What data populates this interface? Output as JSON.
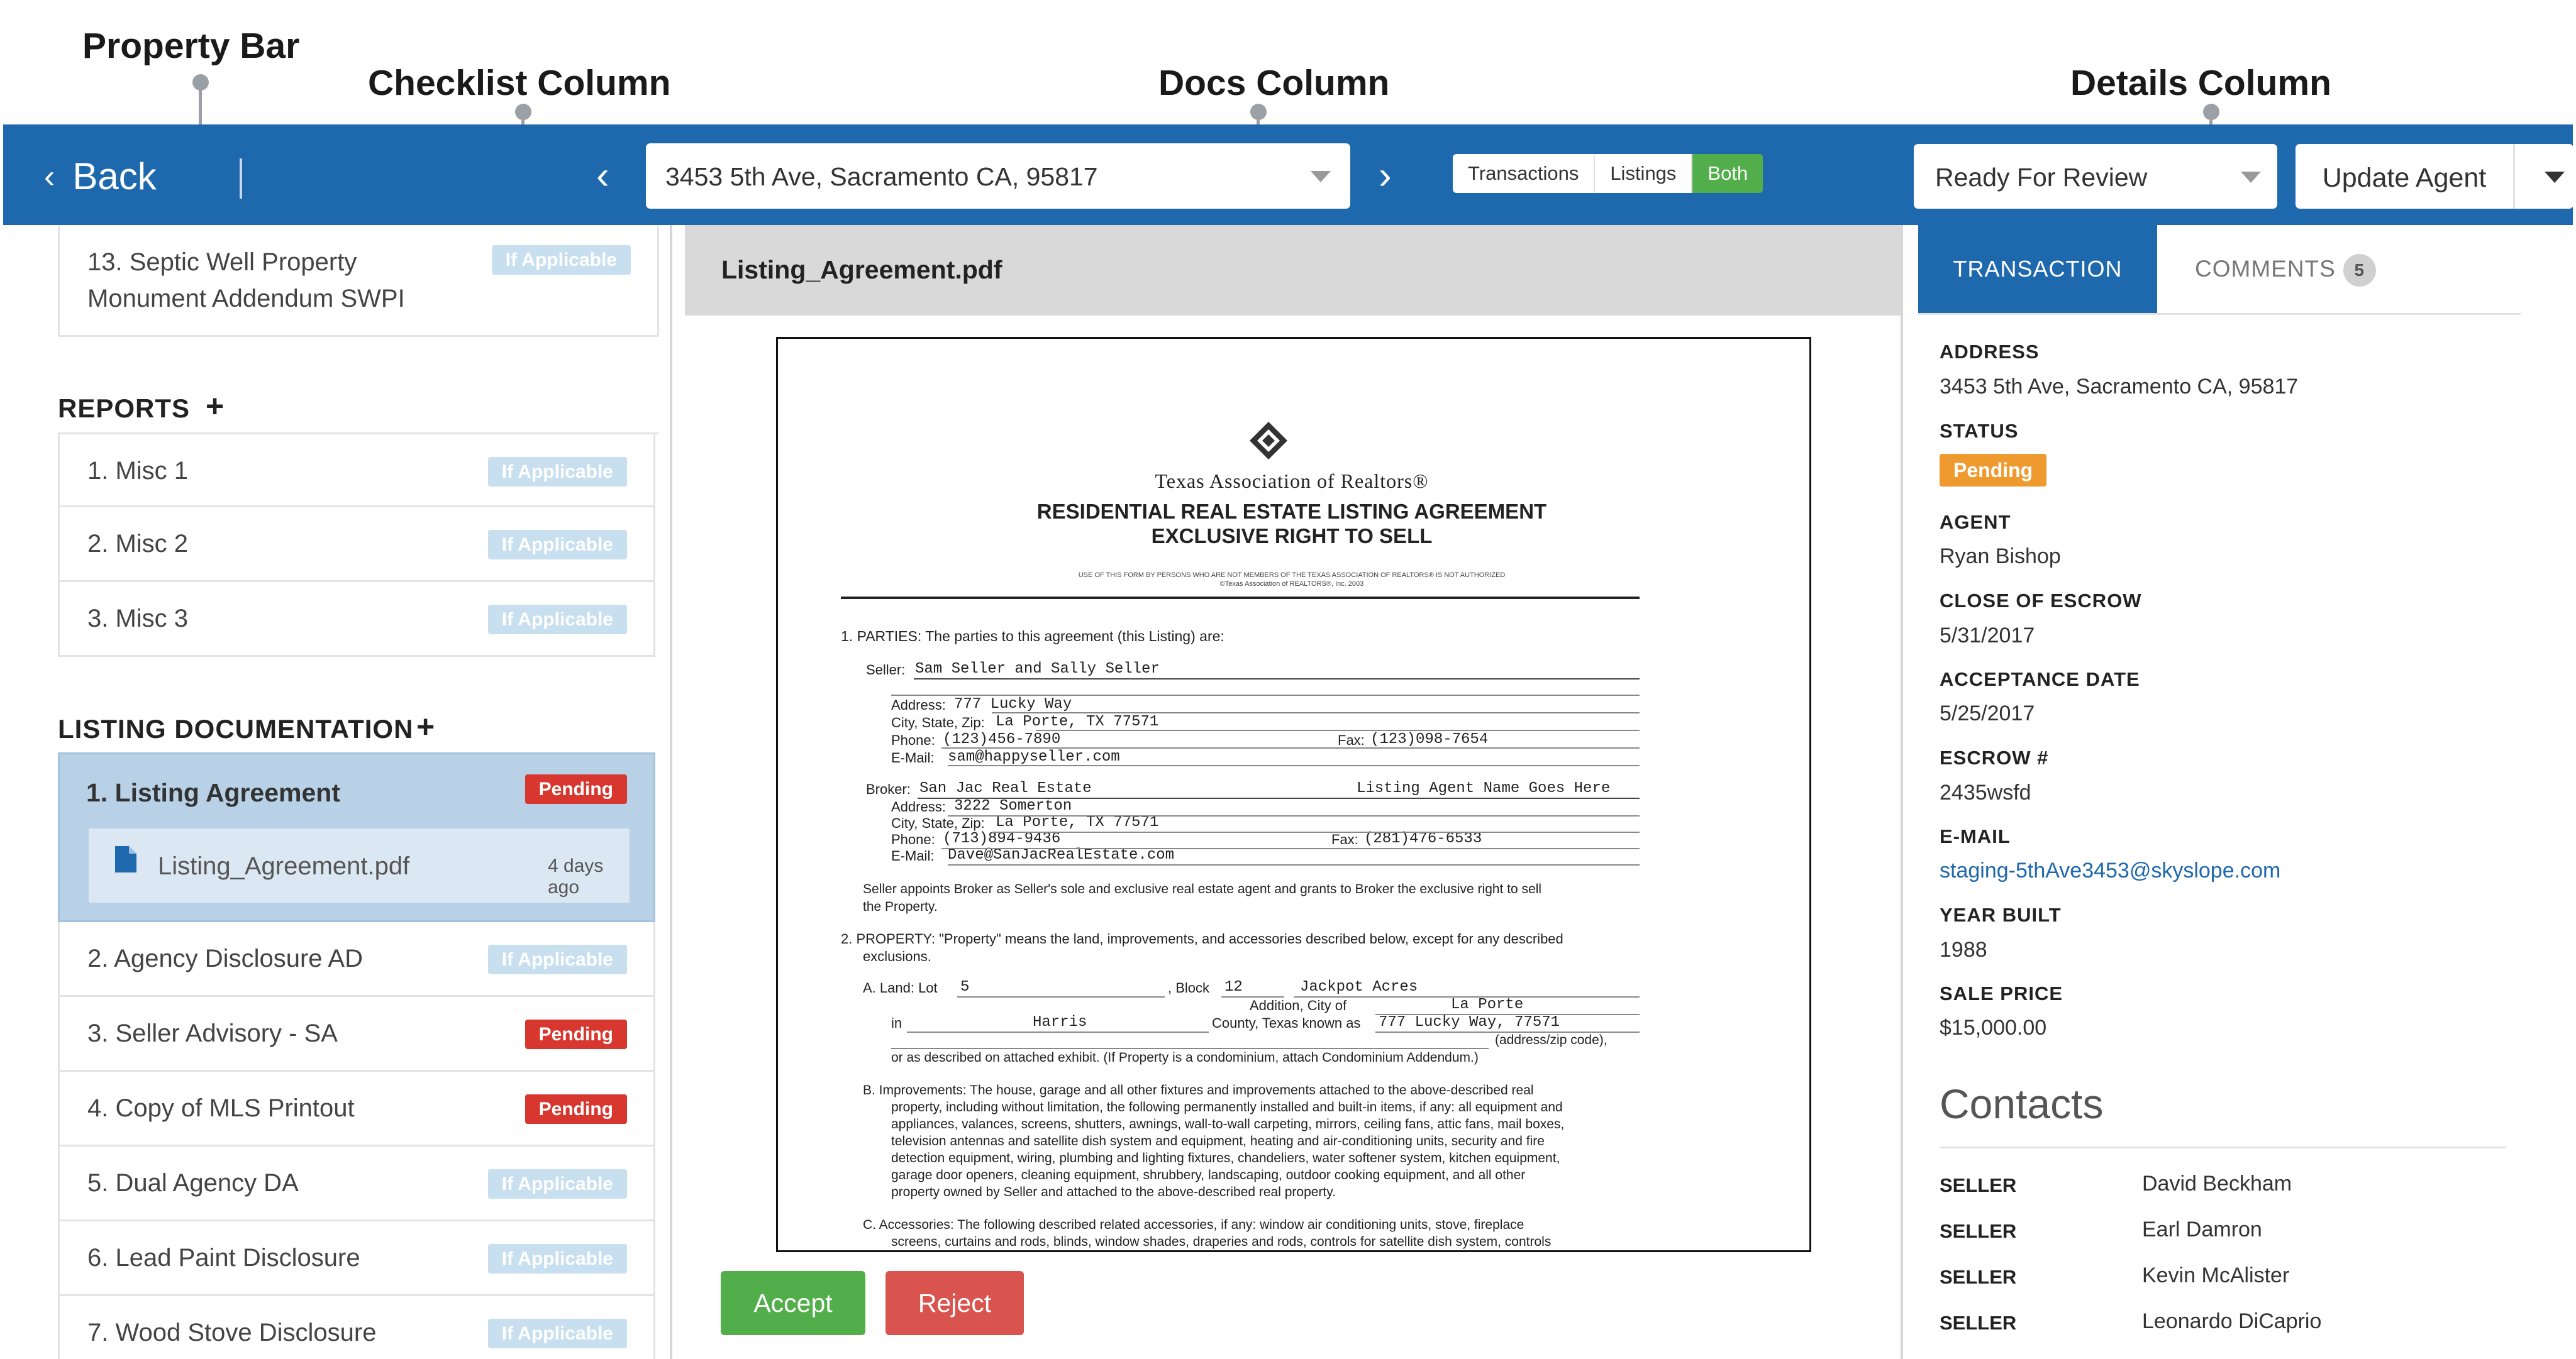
{
  "callouts": {
    "property_bar": "Property Bar",
    "checklist_column": "Checklist Column",
    "docs_column": "Docs Column",
    "details_column": "Details Column"
  },
  "property_bar": {
    "back_label": "Back",
    "address": "3453 5th Ave, Sacramento CA, 95817",
    "toggle": [
      "Transactions",
      "Listings",
      "Both"
    ],
    "toggle_active": "Both",
    "status": "Ready For Review",
    "update_button": "Update Agent"
  },
  "checklist": {
    "top_item": {
      "label_line1": "13. Septic Well Property",
      "label_line2": "Monument Addendum SWPI",
      "badge": "If Applicable"
    },
    "reports": {
      "title": "REPORTS",
      "items": [
        {
          "label": "1. Misc 1",
          "badge": "If Applicable"
        },
        {
          "label": "2. Misc 2",
          "badge": "If Applicable"
        },
        {
          "label": "3. Misc 3",
          "badge": "If Applicable"
        }
      ]
    },
    "listing_documentation": {
      "title": "LISTING DOCUMENTATION",
      "selected": {
        "label": "1. Listing Agreement",
        "badge": "Pending",
        "file_name": "Listing_Agreement.pdf",
        "file_time": "4 days ago"
      },
      "items": [
        {
          "label": "2. Agency Disclosure AD",
          "badge": "If Applicable"
        },
        {
          "label": "3. Seller Advisory - SA",
          "badge": "Pending"
        },
        {
          "label": "4. Copy of MLS Printout",
          "badge": "Pending"
        },
        {
          "label": "5. Dual Agency DA",
          "badge": "If Applicable"
        },
        {
          "label": "6. Lead Paint Disclosure",
          "badge": "If Applicable"
        },
        {
          "label": "7. Wood Stove Disclosure",
          "badge": "If Applicable"
        }
      ]
    }
  },
  "docs": {
    "title": "Listing_Agreement.pdf",
    "accept": "Accept",
    "reject": "Reject",
    "pdf": {
      "org": "Texas Association of Realtors®",
      "heading1": "RESIDENTIAL REAL ESTATE LISTING AGREEMENT",
      "heading2": "EXCLUSIVE RIGHT TO SELL",
      "fineprint1": "USE OF THIS FORM BY PERSONS WHO ARE NOT MEMBERS OF THE TEXAS ASSOCIATION OF REALTORS® IS NOT AUTHORIZED",
      "fineprint2": "©Texas Association of REALTORS®, Inc. 2003",
      "parties": "1.  PARTIES: The parties to this agreement (this Listing) are:",
      "seller_label": "Seller:",
      "seller": "Sam Seller and Sally Seller",
      "address_label": "Address:",
      "seller_address": "777 Lucky Way",
      "csz_label": "City, State, Zip:",
      "seller_csz": "La Porte, TX 77571",
      "phone_label": "Phone:",
      "seller_phone": "(123)456-7890",
      "fax_label": "Fax:",
      "seller_fax": "(123)098-7654",
      "email_label": "E-Mail:",
      "seller_email": "sam@happyseller.com",
      "broker_label": "Broker:",
      "broker": "San Jac Real Estate",
      "broker_agent": "Listing Agent Name Goes Here",
      "broker_address": "3222 Somerton",
      "broker_csz": "La Porte, TX 77571",
      "broker_phone": "(713)894-9436",
      "broker_fax": "(281)476-6533",
      "broker_email": "Dave@SanJacRealEstate.com",
      "appoint1": "Seller appoints Broker as Seller's sole and exclusive real estate agent and grants to Broker the exclusive right to sell",
      "appoint2": "the Property.",
      "property1": "2.  PROPERTY: \"Property\" means the land, improvements, and accessories described below, except for any described",
      "property2": "exclusions.",
      "land_a": "A.  Land: Lot",
      "lot": "5",
      "block_label": ", Block",
      "block": "12",
      "subdiv": "Jackpot Acres",
      "addition_city": "Addition, City of",
      "city": "La Porte",
      "in_label": "in",
      "county": "Harris",
      "county_known": "County, Texas known as",
      "known_as": "777 Lucky Way, 77571",
      "addr_zip": "(address/zip code),",
      "exhibit": "or as described on attached exhibit. (If Property is a condominium, attach Condominium Addendum.)",
      "improve_b": "B.  Improvements: The house, garage and all other fixtures and improvements attached to the above-described real",
      "improve_lines": [
        "property, including without limitation, the following permanently installed and built-in items, if any: all equipment and",
        "appliances, valances, screens, shutters, awnings, wall-to-wall carpeting, mirrors, ceiling fans, attic fans, mail boxes,",
        "television antennas and satellite dish system and equipment, heating and air-conditioning units, security and fire",
        "detection equipment, wiring, plumbing and lighting fixtures, chandeliers, water softener system, kitchen equipment,",
        "garage door openers, cleaning equipment, shrubbery, landscaping, outdoor cooking equipment, and all other",
        "property owned by Seller and attached to the above-described real property."
      ],
      "access_c": "C.  Accessories: The following described related accessories, if any: window air conditioning units, stove, fireplace",
      "access_line2": "screens, curtains and rods, blinds, window shades, draperies and rods, controls for satellite dish system, controls"
    }
  },
  "details": {
    "tab_transaction": "TRANSACTION",
    "tab_comments": "COMMENTS",
    "comments_count": "5",
    "fields": {
      "address_label": "ADDRESS",
      "address": "3453 5th Ave, Sacramento CA, 95817",
      "status_label": "STATUS",
      "status": "Pending",
      "agent_label": "AGENT",
      "agent": "Ryan Bishop",
      "coe_label": "CLOSE OF ESCROW",
      "coe": "5/31/2017",
      "acc_label": "ACCEPTANCE DATE",
      "acc": "5/25/2017",
      "escrow_label": "ESCROW #",
      "escrow": "2435wsfd",
      "email_label": "E-MAIL",
      "email": "staging-5thAve3453@skyslope.com",
      "year_label": "YEAR BUILT",
      "year": "1988",
      "price_label": "SALE PRICE",
      "price": "$15,000.00"
    },
    "contacts_title": "Contacts",
    "contacts": [
      {
        "role": "SELLER",
        "name": "David Beckham"
      },
      {
        "role": "SELLER",
        "name": "Earl Damron"
      },
      {
        "role": "SELLER",
        "name": "Kevin McAlister"
      },
      {
        "role": "SELLER",
        "name": "Leonardo DiCaprio"
      }
    ]
  },
  "colors": {
    "brand_blue": "#1e68ad",
    "pending_red": "#d7372f",
    "accept_green": "#52ae4a",
    "status_orange": "#ef9a2f",
    "if_applicable": "#c8dff0"
  }
}
